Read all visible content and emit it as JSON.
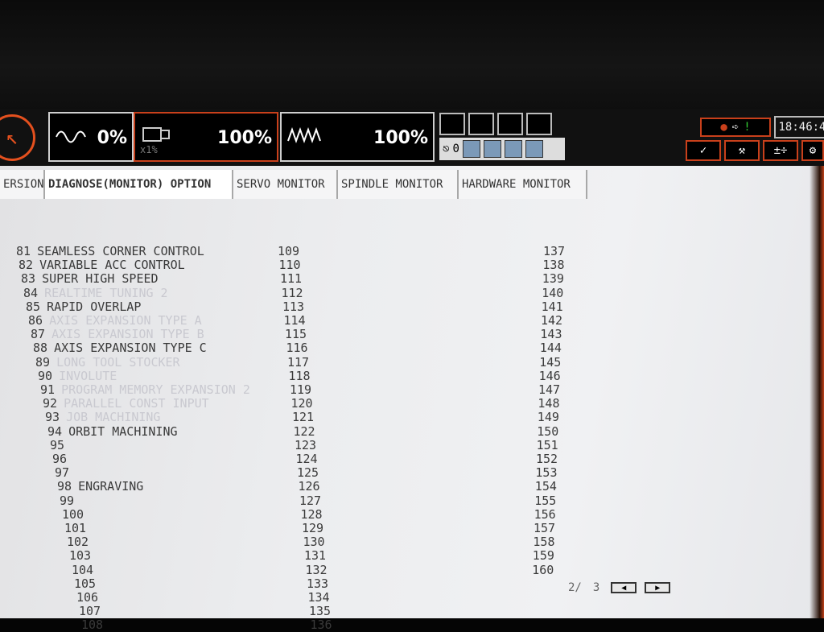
{
  "status_bar": {
    "feed_override": "0%",
    "rapid_override": "100%",
    "rapid_sub": "x1%",
    "spindle_override": "100%",
    "counter_value": "0",
    "clock": "18:46:4",
    "alarm_indicator": "!"
  },
  "tabs": [
    {
      "label": "ERSION"
    },
    {
      "label": "DIAGNOSE(MONITOR) OPTION"
    },
    {
      "label": "SERVO MONITOR"
    },
    {
      "label": "SPINDLE MONITOR"
    },
    {
      "label": "HARDWARE MONITOR"
    }
  ],
  "options_col1": [
    {
      "num": "81",
      "label": "SEAMLESS CORNER CONTROL",
      "enabled": true
    },
    {
      "num": "82",
      "label": "VARIABLE ACC CONTROL",
      "enabled": true
    },
    {
      "num": "83",
      "label": "SUPER HIGH SPEED",
      "enabled": true
    },
    {
      "num": "84",
      "label": "REALTIME TUNING 2",
      "enabled": false
    },
    {
      "num": "85",
      "label": "RAPID OVERLAP",
      "enabled": true
    },
    {
      "num": "86",
      "label": "AXIS EXPANSION TYPE A",
      "enabled": false
    },
    {
      "num": "87",
      "label": "AXIS EXPANSION TYPE B",
      "enabled": false
    },
    {
      "num": "88",
      "label": "AXIS EXPANSION TYPE C",
      "enabled": true
    },
    {
      "num": "89",
      "label": "LONG TOOL STOCKER",
      "enabled": false
    },
    {
      "num": "90",
      "label": "INVOLUTE",
      "enabled": false
    },
    {
      "num": "91",
      "label": "PROGRAM MEMORY EXPANSION 2",
      "enabled": false
    },
    {
      "num": "92",
      "label": "PARALLEL CONST INPUT",
      "enabled": false
    },
    {
      "num": "93",
      "label": "JOB MACHINING",
      "enabled": false
    },
    {
      "num": "94",
      "label": "ORBIT MACHINING",
      "enabled": true
    },
    {
      "num": "95",
      "label": "",
      "enabled": false
    },
    {
      "num": "96",
      "label": "",
      "enabled": false
    },
    {
      "num": "97",
      "label": "",
      "enabled": false
    },
    {
      "num": "98",
      "label": "ENGRAVING",
      "enabled": true
    },
    {
      "num": "99",
      "label": "",
      "enabled": false
    },
    {
      "num": "100",
      "label": "",
      "enabled": false
    },
    {
      "num": "101",
      "label": "",
      "enabled": false
    },
    {
      "num": "102",
      "label": "",
      "enabled": false
    },
    {
      "num": "103",
      "label": "",
      "enabled": false
    },
    {
      "num": "104",
      "label": "",
      "enabled": false
    },
    {
      "num": "105",
      "label": "",
      "enabled": false
    },
    {
      "num": "106",
      "label": "",
      "enabled": false
    },
    {
      "num": "107",
      "label": "",
      "enabled": false
    },
    {
      "num": "108",
      "label": "",
      "enabled": false
    }
  ],
  "options_col2": [
    "109",
    "110",
    "111",
    "112",
    "113",
    "114",
    "115",
    "116",
    "117",
    "118",
    "119",
    "120",
    "121",
    "122",
    "123",
    "124",
    "125",
    "126",
    "127",
    "128",
    "129",
    "130",
    "131",
    "132",
    "133",
    "134",
    "135",
    "136"
  ],
  "options_col3": [
    "137",
    "138",
    "139",
    "140",
    "141",
    "142",
    "143",
    "144",
    "145",
    "146",
    "147",
    "148",
    "149",
    "150",
    "151",
    "152",
    "153",
    "154",
    "155",
    "156",
    "157",
    "158",
    "159",
    "160"
  ],
  "pager": {
    "current": "2/",
    "total": "3",
    "prev_icon": "triangle-left-icon",
    "next_icon": "triangle-right-icon"
  },
  "colors": {
    "accent": "#c9401b",
    "screen_bg": "#ecedef",
    "text": "#3a3a3a"
  }
}
